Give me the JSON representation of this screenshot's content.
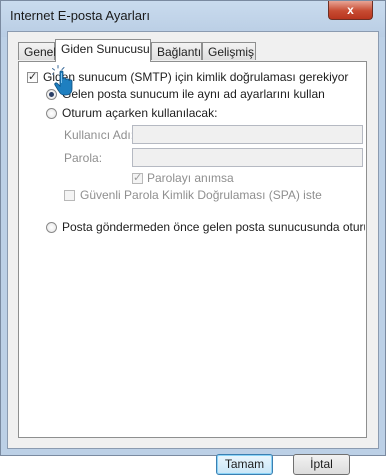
{
  "window": {
    "title": "Internet E-posta Ayarları",
    "close_glyph": "x"
  },
  "tabs": [
    {
      "label": "Genel",
      "active": false
    },
    {
      "label": "Giden Sunucusu",
      "active": true
    },
    {
      "label": "Bağlantı",
      "active": false
    },
    {
      "label": "Gelişmiş",
      "active": false
    }
  ],
  "outgoing": {
    "auth_required": {
      "label": "Giden sunucum (SMTP) için kimlik doğrulaması gerekiyor",
      "checked": true
    },
    "use_same_settings": {
      "label": "Gelen posta sunucum ile aynı ad ayarlarını kullan",
      "selected": true
    },
    "log_on_using": {
      "label": "Oturum açarken kullanılacak:",
      "selected": false
    },
    "username": {
      "label": "Kullanıcı Adı:",
      "value": ""
    },
    "password": {
      "label": "Parola:",
      "value": ""
    },
    "remember_password": {
      "label": "Parolayı anımsa",
      "checked": true,
      "enabled": false
    },
    "spa": {
      "label": "Güvenli Parola Kimlik Doğrulaması (SPA) iste",
      "checked": false,
      "enabled": false
    },
    "log_on_incoming": {
      "label": "Posta göndermeden önce gelen posta sunucusunda oturum aç",
      "selected": false
    }
  },
  "buttons": {
    "ok": "Tamam",
    "cancel": "İptal"
  },
  "colors": {
    "title_bar": "#bcd0e6",
    "close_button": "#c74b32",
    "default_button_border": "#3c7fb1",
    "cursor": "#1e7fc0"
  },
  "icons": {
    "cursor": "hand-pointer-icon"
  }
}
